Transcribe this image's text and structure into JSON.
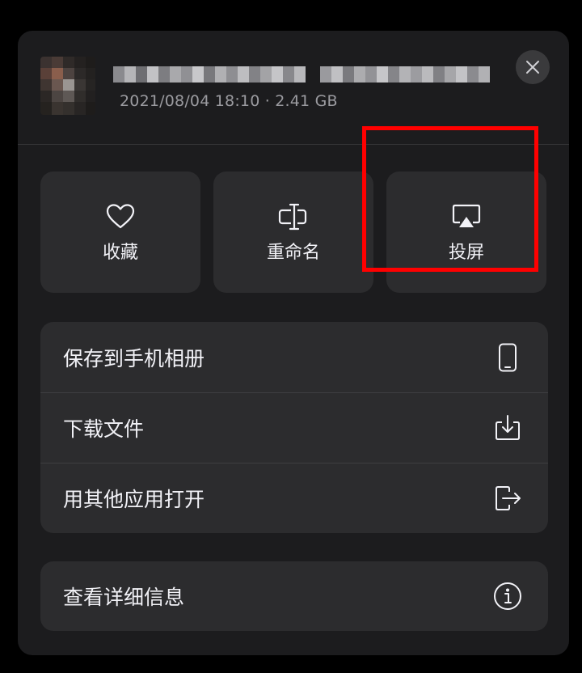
{
  "header": {
    "meta": "2021/08/04 18:10 · 2.41 GB",
    "thumbnail_icon": "blurred-thumbnail",
    "title_icon": "blurred-filename",
    "close_icon": "close-icon"
  },
  "actions": [
    {
      "label": "收藏",
      "icon": "heart-icon"
    },
    {
      "label": "重命名",
      "icon": "rename-icon"
    },
    {
      "label": "投屏",
      "icon": "airplay-icon"
    }
  ],
  "menu": [
    {
      "label": "保存到手机相册",
      "icon": "phone-icon"
    },
    {
      "label": "下载文件",
      "icon": "download-icon"
    },
    {
      "label": "用其他应用打开",
      "icon": "open-external-icon"
    }
  ],
  "details": {
    "label": "查看详细信息",
    "icon": "info-icon"
  },
  "colors": {
    "background": "#000000",
    "sheet": "#1c1c1e",
    "tile": "#2c2c2e",
    "text": "#f2f2f7",
    "meta_text": "#9b9ba0",
    "highlight": "#ff0000"
  }
}
